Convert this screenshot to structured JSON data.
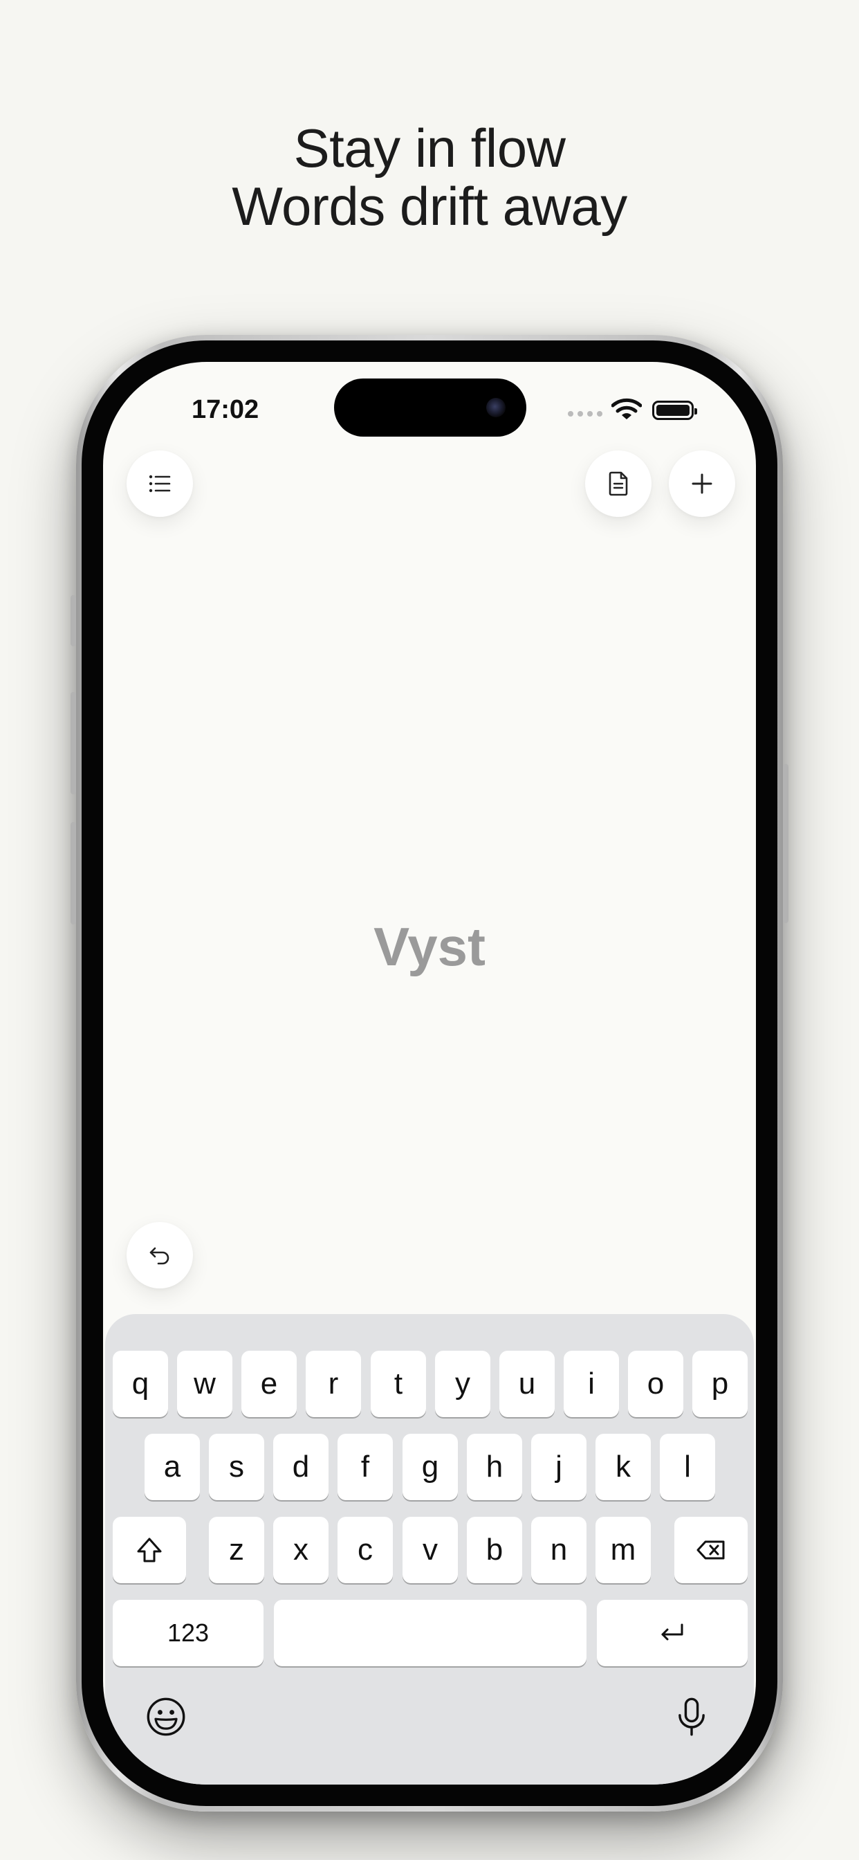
{
  "headline": {
    "line1": "Stay in flow",
    "line2": "Words drift away"
  },
  "status_bar": {
    "time": "17:02"
  },
  "toolbar": {
    "list_icon": "list-icon",
    "document_icon": "document-icon",
    "add_icon": "plus-icon",
    "undo_icon": "undo-icon"
  },
  "editor": {
    "word": "Vyst"
  },
  "keyboard": {
    "row1": [
      "q",
      "w",
      "e",
      "r",
      "t",
      "y",
      "u",
      "i",
      "o",
      "p"
    ],
    "row2": [
      "a",
      "s",
      "d",
      "f",
      "g",
      "h",
      "j",
      "k",
      "l"
    ],
    "row3": [
      "z",
      "x",
      "c",
      "v",
      "b",
      "n",
      "m"
    ],
    "numbers_label": "123",
    "space_label": "",
    "icons": [
      "shift-icon",
      "delete-icon",
      "return-icon",
      "emoji-icon",
      "microphone-icon"
    ]
  }
}
